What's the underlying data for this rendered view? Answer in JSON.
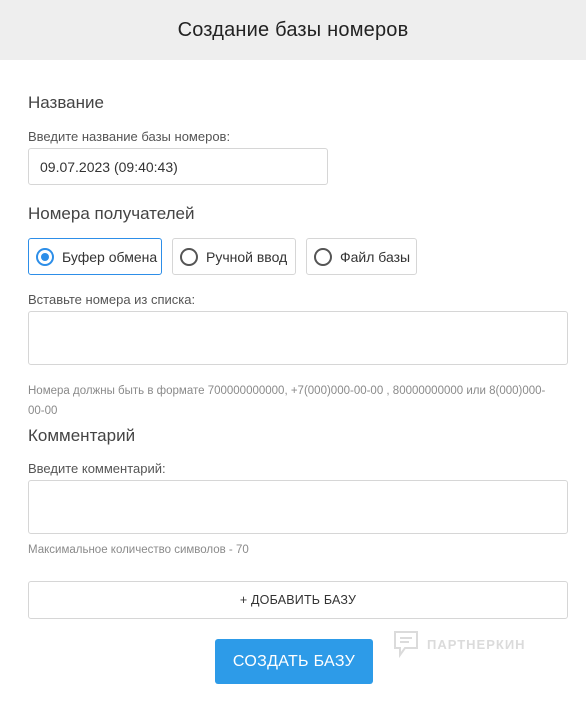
{
  "header": {
    "title": "Создание базы номеров"
  },
  "name_section": {
    "title": "Название",
    "input_label": "Введите название базы номеров:",
    "input_value": "09.07.2023 (09:40:43)"
  },
  "recipients_section": {
    "title": "Номера получателей",
    "options": [
      {
        "label": "Буфер обмена",
        "selected": true
      },
      {
        "label": "Ручной ввод",
        "selected": false
      },
      {
        "label": "Файл базы",
        "selected": false
      }
    ],
    "paste_label": "Вставьте номера из списка:",
    "paste_value": "",
    "format_hint": "Номера должны быть в формате 700000000000, +7(000)000-00-00 , 80000000000 или 8(000)000-00-00"
  },
  "comment_section": {
    "title": "Комментарий",
    "input_label": "Введите комментарий:",
    "input_value": "",
    "max_hint": "Максимальное количество символов - 70"
  },
  "actions": {
    "add_label": "+ ДОБАВИТЬ БАЗУ",
    "submit_label": "СОЗДАТЬ БАЗУ"
  },
  "watermark": {
    "text": "ПАРТНЕРКИН"
  },
  "colors": {
    "accent": "#2d9be8",
    "radio_active": "#2d8ee8",
    "header_bg": "#eeeeee"
  }
}
